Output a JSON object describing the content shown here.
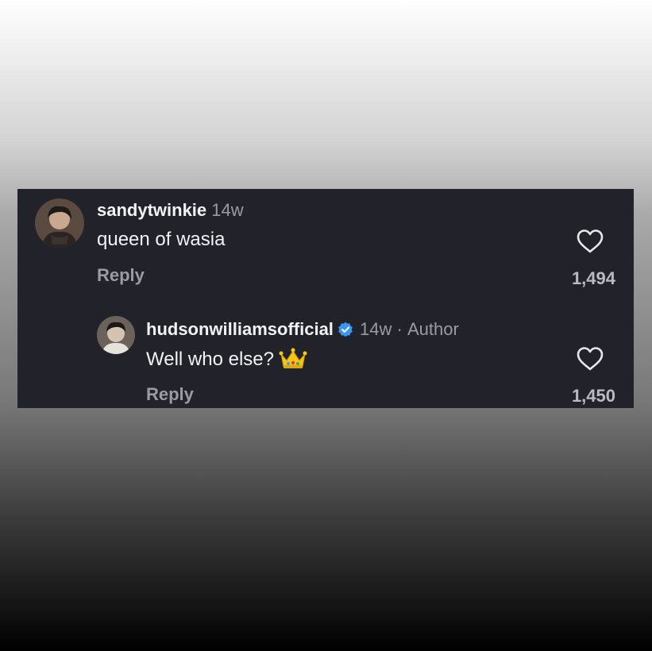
{
  "comments": [
    {
      "username": "sandytwinkie",
      "time": "14w",
      "text": "queen of wasia",
      "reply_label": "Reply",
      "likes": "1,494"
    },
    {
      "username": "hudsonwilliamsofficial",
      "time": "14w",
      "separator": "·",
      "author_label": "Author",
      "text": "Well who else?",
      "emoji": "crown",
      "reply_label": "Reply",
      "likes": "1,450",
      "verified": true
    }
  ],
  "colors": {
    "panel": "#22232a",
    "username": "#f2f2f2",
    "meta": "#9a9ca3",
    "verified": "#3897f0"
  }
}
